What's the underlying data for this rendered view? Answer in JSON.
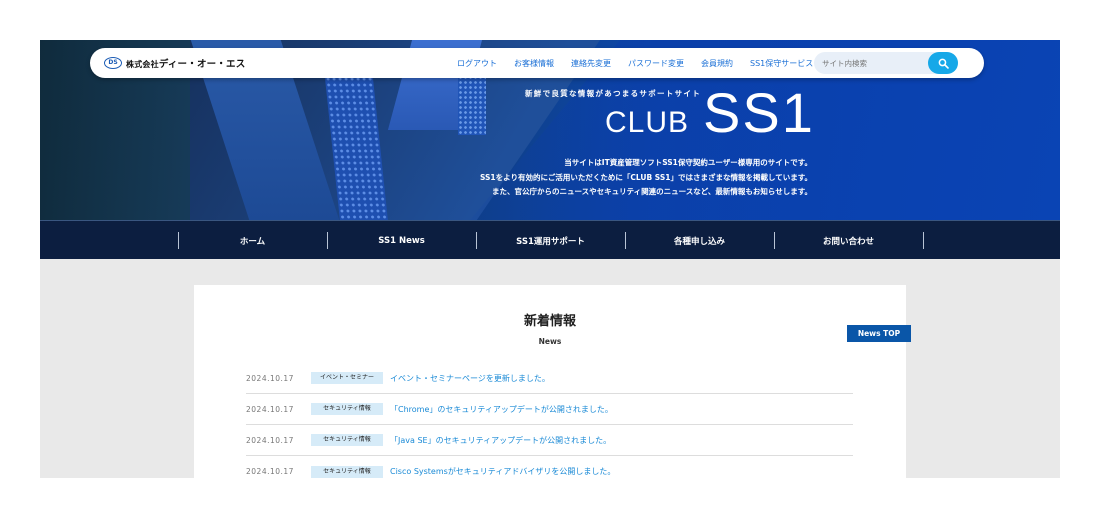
{
  "header": {
    "logo_mark": "DS",
    "logo_prefix": "株式会社",
    "logo_name": "ディー・オー・エス",
    "nav": [
      "ログアウト",
      "お客様情報",
      "連絡先変更",
      "パスワード変更",
      "会員規約",
      "SS1保守サービス"
    ],
    "search": {
      "placeholder": "サイト内検索"
    }
  },
  "hero": {
    "tagline": "新鮮で良質な情報があつまるサポートサイト",
    "brand_club": "CLUB",
    "brand_ss1": "SS1",
    "description": [
      "当サイトはIT資産管理ソフトSS1保守契約ユーザー様専用のサイトです。",
      "SS1をより有効的にご活用いただくために「CLUB SS1」ではさまざまな情報を掲載しています。",
      "また、官公庁からのニュースやセキュリティ関連のニュースなど、最新情報もお知らせします。"
    ]
  },
  "main_nav": [
    "ホーム",
    "SS1 News",
    "SS1運用サポート",
    "各種申し込み",
    "お問い合わせ"
  ],
  "news": {
    "title": "新着情報",
    "subtitle": "News",
    "top_button": "News TOP",
    "items": [
      {
        "date": "2024.10.17",
        "category": "イベント・セミナー",
        "text": "イベント・セミナーページを更新しました。"
      },
      {
        "date": "2024.10.17",
        "category": "セキュリティ情報",
        "text": "「Chrome」のセキュリティアップデートが公開されました。"
      },
      {
        "date": "2024.10.17",
        "category": "セキュリティ情報",
        "text": "「Java SE」のセキュリティアップデートが公開されました。"
      },
      {
        "date": "2024.10.17",
        "category": "セキュリティ情報",
        "text": "Cisco Systemsがセキュリティアドバイザリを公開しました。"
      }
    ]
  },
  "colors": {
    "accent": "#16a8e8",
    "nav_bg": "#0c1e40",
    "link": "#1a8ad6",
    "button": "#0a56a8"
  },
  "icons": {
    "search": "search-icon"
  }
}
